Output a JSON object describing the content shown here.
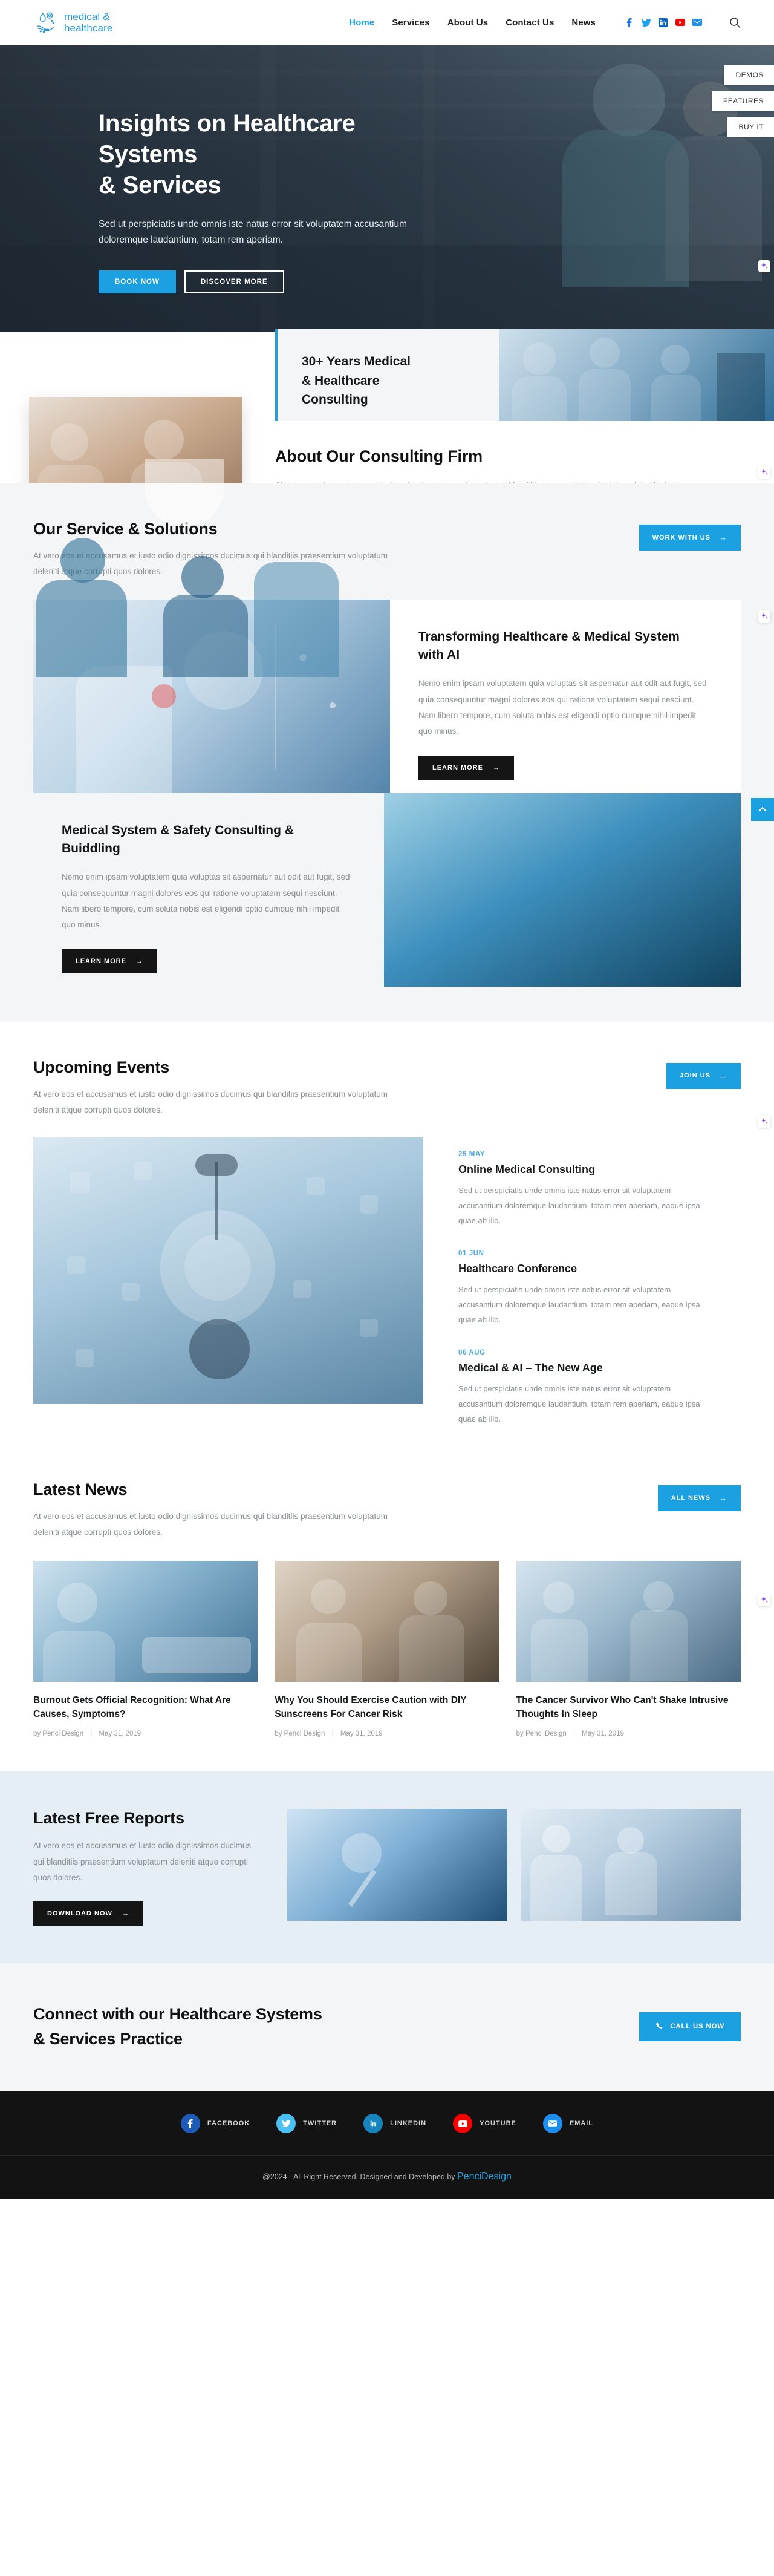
{
  "header": {
    "logo": {
      "line1": "medical &",
      "line2": "healthcare",
      "icon": "hand-drop-icon"
    },
    "nav": [
      {
        "label": "Home",
        "active": true
      },
      {
        "label": "Services",
        "active": false
      },
      {
        "label": "About Us",
        "active": false
      },
      {
        "label": "Contact Us",
        "active": false
      },
      {
        "label": "News",
        "active": false
      }
    ],
    "social": [
      "facebook-icon",
      "twitter-icon",
      "linkedin-icon",
      "youtube-icon",
      "email-icon"
    ],
    "search_label": "search-icon"
  },
  "side_tabs": [
    {
      "label": "DEMOS"
    },
    {
      "label": "FEATURES"
    },
    {
      "label": "BUY IT"
    }
  ],
  "hero": {
    "title_line1": "Insights on Healthcare Systems",
    "title_line2": "& Services",
    "paragraph": "Sed ut perspiciatis unde omnis iste natus error sit voluptatem accusantium doloremque laudantium, totam rem aperiam.",
    "primary_button": "BOOK NOW",
    "secondary_button": "DISCOVER MORE"
  },
  "about": {
    "badge_line1": "30+ Years Medical",
    "badge_line2": "& Healthcare",
    "badge_line3": "Consulting",
    "title": "About Our Consulting Firm",
    "paragraph": "At vero eos et accusamus et iusto odio dignissimos ducimus qui blanditiis praesentium voluptatum deleniti atque corrupti quos dolores et quas molestias excepturi sint occaecati cupiditate non provident, similique sunt in culpa qui officia. Nam libero tempore, cum soluta nobis est eligendi optio cumque nihil."
  },
  "services": {
    "title": "Our Service & Solutions",
    "paragraph": "At vero eos et accusamus et iusto odio dignissimos ducimus qui blanditiis praesentium voluptatum deleniti atque corrupti quos dolores.",
    "cta": "WORK WITH US",
    "items": [
      {
        "title": "Transforming Healthcare & Medical System with AI",
        "paragraph": "Nemo enim ipsam voluptatem quia voluptas sit aspernatur aut odit aut fugit, sed quia consequuntur magni dolores eos qui ratione voluptatem sequi nesciunt. Nam libero tempore, cum soluta nobis est eligendi optio cumque nihil impedit quo minus.",
        "button": "LEARN MORE"
      },
      {
        "title": "Medical System & Safety Consulting & Buiddling",
        "paragraph": "Nemo enim ipsam voluptatem quia voluptas sit aspernatur aut odit aut fugit, sed quia consequuntur magni dolores eos qui ratione voluptatem sequi nesciunt. Nam libero tempore, cum soluta nobis est eligendi optio cumque nihil impedit quo minus.",
        "button": "LEARN MORE"
      }
    ]
  },
  "events": {
    "title": "Upcoming Events",
    "paragraph": "At vero eos et accusamus et iusto odio dignissimos ducimus qui blanditiis praesentium voluptatum deleniti atque corrupti quos dolores.",
    "cta": "JOIN US",
    "items": [
      {
        "date": "25 MAY",
        "title": "Online Medical Consulting",
        "paragraph": "Sed ut perspiciatis unde omnis iste natus error sit voluptatem accusantium doloremque laudantium, totam rem aperiam, eaque ipsa quae ab illo."
      },
      {
        "date": "01 JUN",
        "title": "Healthcare Conference",
        "paragraph": "Sed ut perspiciatis unde omnis iste natus error sit voluptatem accusantium doloremque laudantium, totam rem aperiam, eaque ipsa quae ab illo."
      },
      {
        "date": "06 AUG",
        "title": "Medical & AI – The New Age",
        "paragraph": "Sed ut perspiciatis unde omnis iste natus error sit voluptatem accusantium doloremque laudantium, totam rem aperiam, eaque ipsa quae ab illo."
      }
    ]
  },
  "news": {
    "title": "Latest News",
    "paragraph": "At vero eos et accusamus et iusto odio dignissimos ducimus qui blanditiis praesentium voluptatum deleniti atque corrupti quos dolores.",
    "cta": "ALL NEWS",
    "items": [
      {
        "title": "Burnout Gets Official Recognition: What Are Causes, Symptoms?",
        "author": "by Penci Design",
        "date": "May 31, 2019"
      },
      {
        "title": "Why You Should Exercise Caution with DIY Sunscreens For Cancer Risk",
        "author": "by Penci Design",
        "date": "May 31, 2019"
      },
      {
        "title": "The Cancer Survivor Who Can't Shake Intrusive Thoughts In Sleep",
        "author": "by Penci Design",
        "date": "May 31, 2019"
      }
    ]
  },
  "reports": {
    "title": "Latest Free Reports",
    "paragraph": "At vero eos et accusamus et iusto odio dignissimos ducimus qui blanditiis praesentium voluptatum deleniti atque corrupti quos dolores.",
    "button": "DOWNLOAD NOW"
  },
  "connect": {
    "title_line1": "Connect with our Healthcare Systems",
    "title_line2": "& Services Practice",
    "button": "CALL US NOW",
    "button_icon": "phone-icon"
  },
  "footer": {
    "social": [
      {
        "label": "FACEBOOK",
        "icon": "facebook-icon",
        "color": "#1c5ab5"
      },
      {
        "label": "TWITTER",
        "icon": "twitter-icon",
        "color": "#4ac1f5"
      },
      {
        "label": "LINKEDIN",
        "icon": "linkedin-icon",
        "color": "#1884bd"
      },
      {
        "label": "YOUTUBE",
        "icon": "youtube-icon",
        "color": "#f90000"
      },
      {
        "label": "EMAIL",
        "icon": "email-icon",
        "color": "#1b8ef0"
      }
    ],
    "copyright_prefix": "@2024 - All Right Reserved. Designed and Developed by ",
    "copyright_link": "PenciDesign"
  },
  "colors": {
    "accent": "#1ba1e2",
    "dark": "#151515",
    "grey_bg": "#f4f5f6",
    "blue_bg": "#e5edf5"
  }
}
